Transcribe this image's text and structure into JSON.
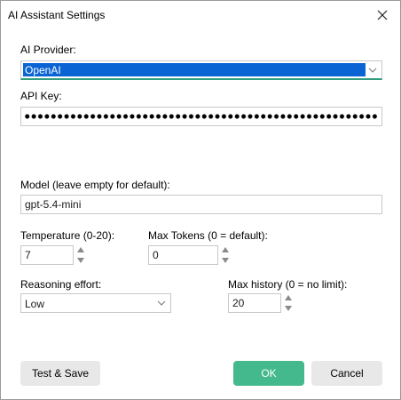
{
  "window": {
    "title": "AI Assistant Settings"
  },
  "provider": {
    "label": "AI Provider:",
    "selected": "OpenAI"
  },
  "api_key": {
    "label": "API Key:"
  },
  "model": {
    "label": "Model (leave empty for default):",
    "value": "gpt-5.4-mini"
  },
  "temperature": {
    "label": "Temperature (0-20):",
    "value": "7"
  },
  "max_tokens": {
    "label": "Max Tokens (0 = default):",
    "value": "0"
  },
  "reasoning": {
    "label": "Reasoning effort:",
    "selected": "Low"
  },
  "max_history": {
    "label": "Max history (0 = no limit):",
    "value": "20"
  },
  "buttons": {
    "test_save": "Test & Save",
    "ok": "OK",
    "cancel": "Cancel"
  },
  "colors": {
    "selection": "#0a64d4",
    "accent": "#45b98e",
    "focus_underline": "#2f9d7e"
  },
  "icons": {
    "close": "close-icon",
    "dropdown": "chevron-down-icon",
    "spin_up": "arrow-up-icon",
    "spin_down": "arrow-down-icon"
  }
}
